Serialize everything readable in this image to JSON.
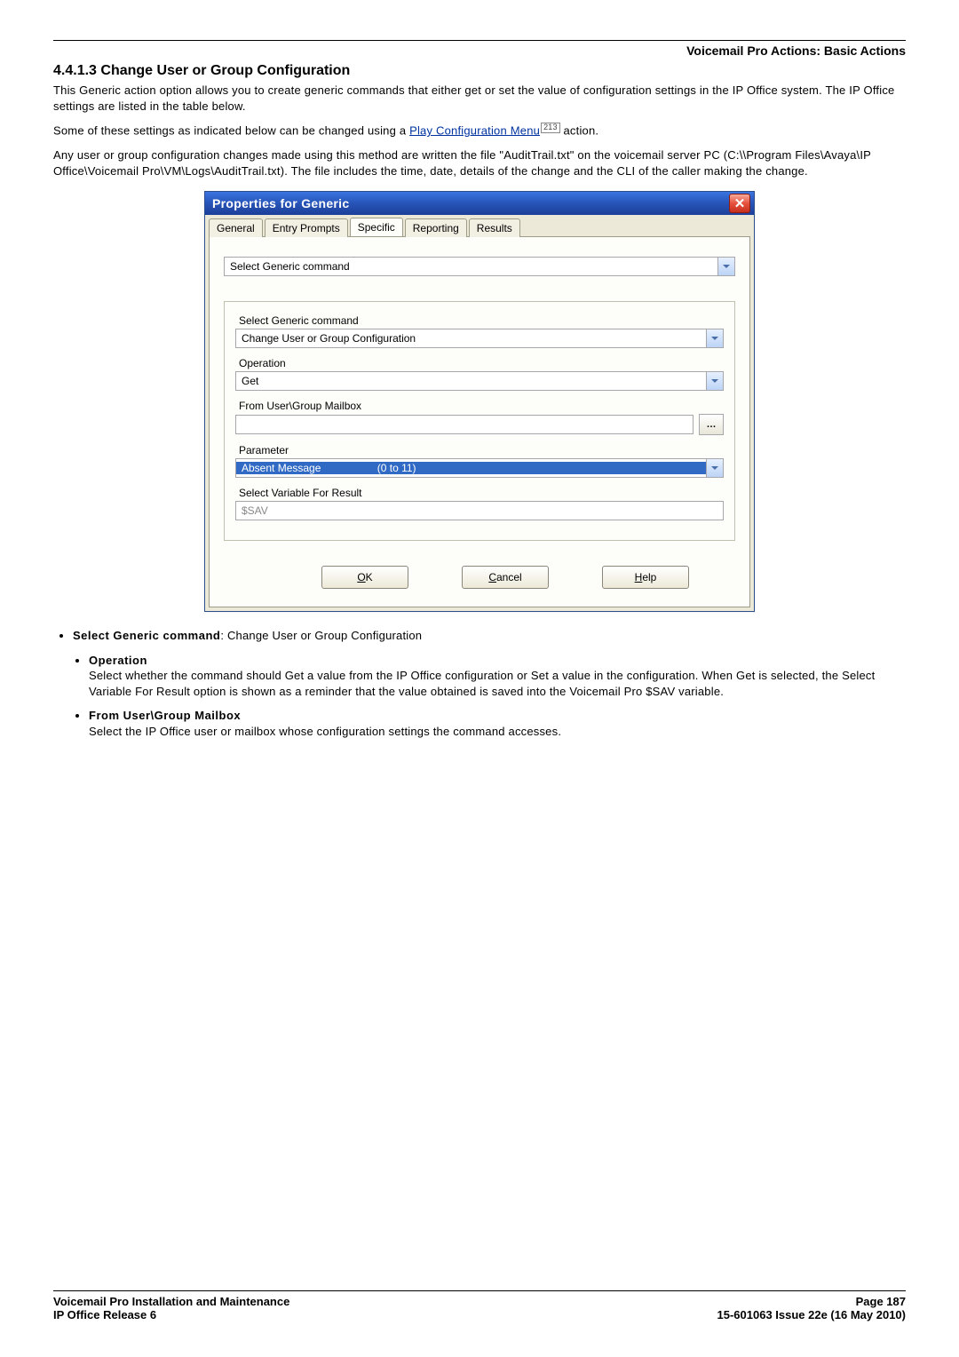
{
  "header_tag": "Voicemail Pro Actions: Basic Actions",
  "section_number": "4.4.1.3",
  "section_title": "Change User or Group Configuration",
  "paragraphs": {
    "p1": "This Generic action option allows you to create generic commands that either get or set the value of configuration settings in the IP Office system. The IP Office settings are listed in the table below.",
    "p2a": "Some of these settings as indicated below can be changed using a ",
    "p2_link": "Play Configuration Menu",
    "p2_ref": "213",
    "p2b": " action.",
    "p3": "Any user or group configuration changes made using this method are written the file \"AuditTrail.txt\" on the voicemail server PC (C:\\\\Program Files\\Avaya\\IP Office\\Voicemail Pro\\VM\\Logs\\AuditTrail.txt). The file includes the time, date, details of the change and the CLI of the caller making the change."
  },
  "dialog": {
    "title": "Properties for Generic",
    "tabs": [
      "General",
      "Entry Prompts",
      "Specific",
      "Reporting",
      "Results"
    ],
    "active_tab": 2,
    "fields": {
      "top_combo": {
        "label": "",
        "value": "Select Generic command"
      },
      "generic_cmd": {
        "label": "Select Generic command",
        "value": "Change User or Group Configuration"
      },
      "operation": {
        "label": "Operation",
        "value": "Get"
      },
      "mailbox": {
        "label": "From User\\Group Mailbox",
        "value": ""
      },
      "parameter": {
        "label": "Parameter",
        "value": "Absent Message",
        "extra": "(0 to 11)"
      },
      "result_var": {
        "label": "Select Variable For Result",
        "value": "$SAV"
      }
    },
    "buttons": {
      "ok": "OK",
      "cancel": "Cancel",
      "help": "Help"
    }
  },
  "bullets": {
    "b1_prefix": "Select Generic command",
    "b1_value": ": Change User or Group Configuration",
    "sb1_head": "Operation",
    "sb1_body": "Select whether the command should Get a value from the IP Office configuration or Set a value in the configuration. When Get is selected, the Select Variable For Result option is shown as a reminder that the value obtained is saved into the Voicemail Pro $SAV variable.",
    "sb2_head": "From User\\Group Mailbox",
    "sb2_body": "Select the IP Office user or mailbox whose configuration settings the command accesses."
  },
  "footer": {
    "left1": "Voicemail Pro Installation and Maintenance",
    "left2": "IP Office Release 6",
    "right1": "Page 187",
    "right2": "15-601063 Issue 22e (16 May 2010)"
  }
}
